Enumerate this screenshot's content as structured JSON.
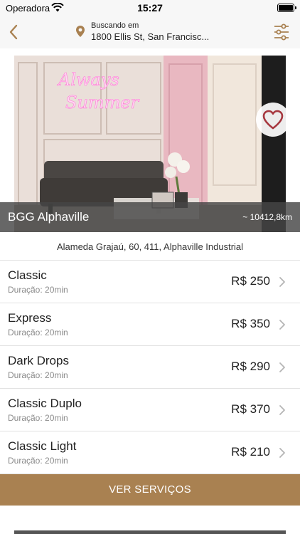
{
  "status_bar": {
    "carrier": "Operadora",
    "time": "15:27"
  },
  "header": {
    "searching_label": "Buscando em",
    "location": "1800 Ellis St, San Francisc...",
    "icons": {
      "back": "chevron-left-icon",
      "pin": "map-pin-icon",
      "filter": "sliders-icon"
    }
  },
  "venue": {
    "name": "BGG Alphaville",
    "distance": "~ 10412,8km",
    "address": "Alameda Grajaú, 60, 411, Alphaville Industrial",
    "neon_text": [
      "Always",
      "Summer"
    ]
  },
  "services": [
    {
      "title": "Classic",
      "duration": "Duração: 20min",
      "price": "R$ 250"
    },
    {
      "title": "Express",
      "duration": "Duração: 20min",
      "price": "R$ 350"
    },
    {
      "title": "Dark Drops",
      "duration": "Duração: 20min",
      "price": "R$ 290"
    },
    {
      "title": "Classic Duplo",
      "duration": "Duração: 20min",
      "price": "R$ 370"
    },
    {
      "title": "Classic Light",
      "duration": "Duração: 20min",
      "price": "R$ 210"
    }
  ],
  "cta": {
    "label": "VER SERVIÇOS"
  },
  "colors": {
    "accent": "#a98151",
    "header_bg": "#f7f7f7",
    "neon": "#ff7ad6"
  }
}
